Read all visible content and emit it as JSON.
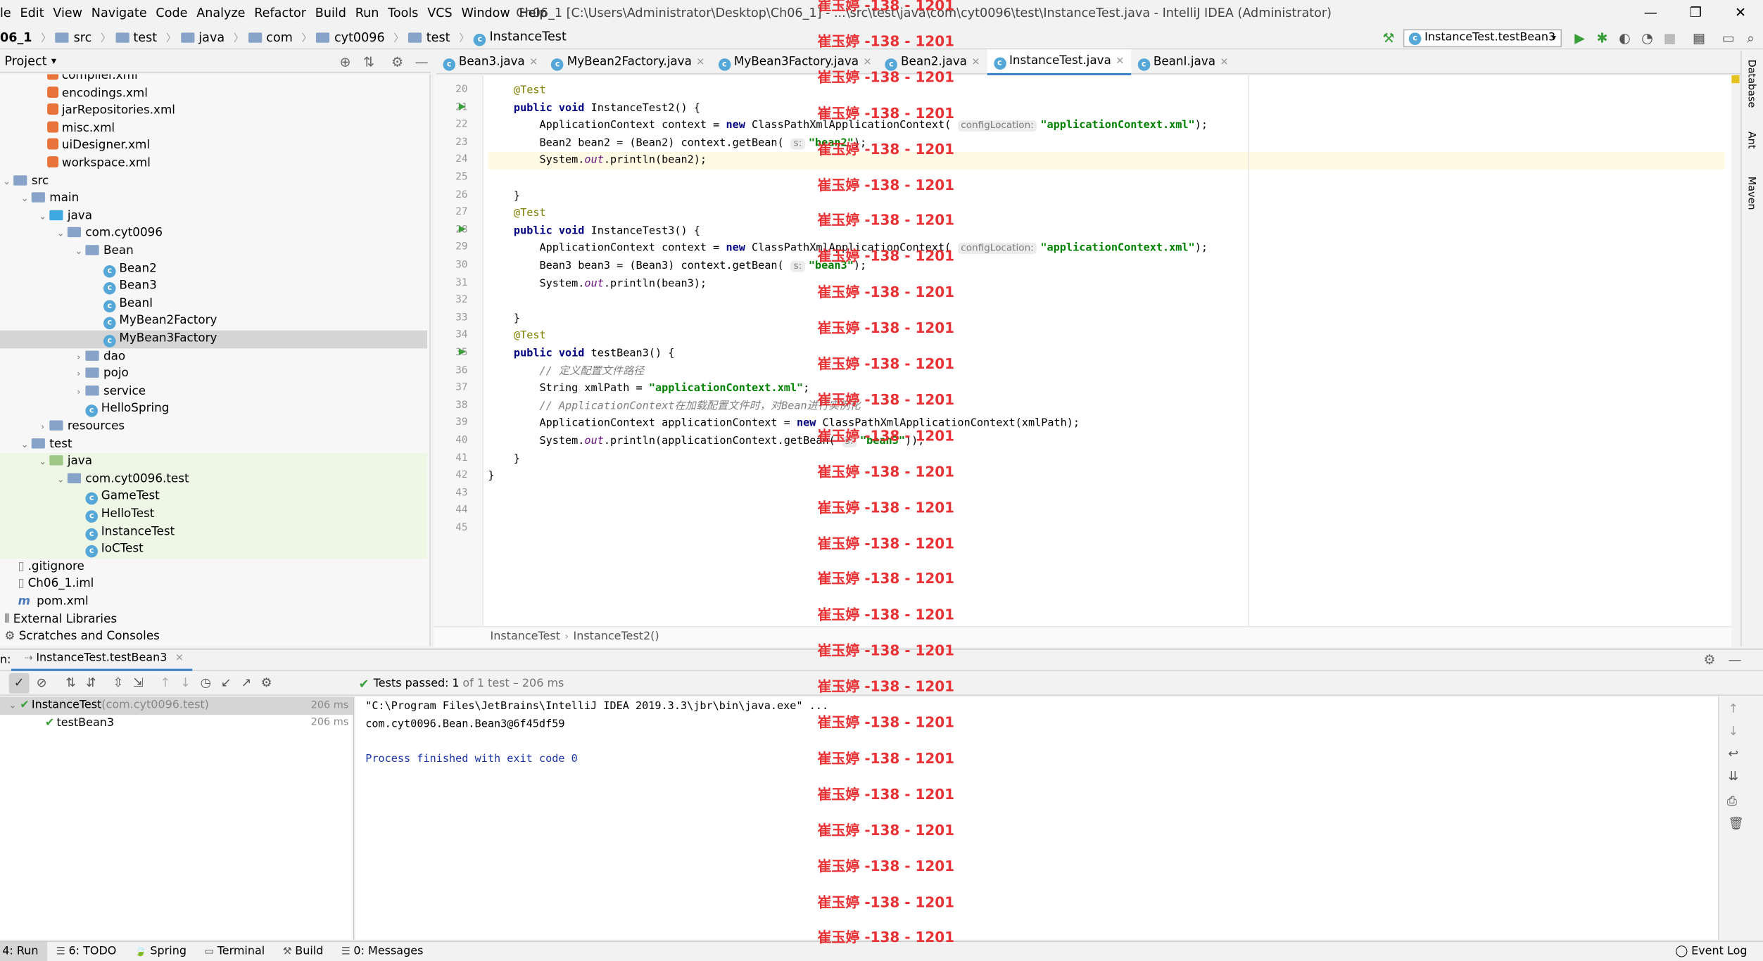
{
  "menu": [
    "le",
    "Edit",
    "View",
    "Navigate",
    "Code",
    "Analyze",
    "Refactor",
    "Build",
    "Run",
    "Tools",
    "VCS",
    "Window",
    "Help"
  ],
  "window_title": "Ch06_1 [C:\\Users\\Administrator\\Desktop\\Ch06_1] - ...\\src\\test\\java\\com\\cyt0096\\test\\InstanceTest.java - IntelliJ IDEA (Administrator)",
  "window_controls": {
    "minimize": "—",
    "restore": "❐",
    "close": "✕"
  },
  "breadcrumb": [
    "06_1",
    "src",
    "test",
    "java",
    "com",
    "cyt0096",
    "test",
    "InstanceTest"
  ],
  "run_config": "InstanceTest.testBean3",
  "project_panel": {
    "title": "Project",
    "dropdown": "▾"
  },
  "tree": [
    {
      "label": "compiler.xml",
      "indent": 30,
      "icon": "xml"
    },
    {
      "label": "encodings.xml",
      "indent": 30,
      "icon": "xml"
    },
    {
      "label": "jarRepositories.xml",
      "indent": 30,
      "icon": "xml"
    },
    {
      "label": "misc.xml",
      "indent": 30,
      "icon": "xml"
    },
    {
      "label": "uiDesigner.xml",
      "indent": 30,
      "icon": "xml"
    },
    {
      "label": "workspace.xml",
      "indent": 30,
      "icon": "xml"
    },
    {
      "label": "src",
      "indent": 0,
      "icon": "folder",
      "arrow": "v"
    },
    {
      "label": "main",
      "indent": 16,
      "icon": "folder",
      "arrow": "v"
    },
    {
      "label": "java",
      "indent": 32,
      "icon": "folder-blue",
      "arrow": "v"
    },
    {
      "label": "com.cyt0096",
      "indent": 48,
      "icon": "folder",
      "arrow": "v"
    },
    {
      "label": "Bean",
      "indent": 64,
      "icon": "folder",
      "arrow": "v"
    },
    {
      "label": "Bean2",
      "indent": 80,
      "icon": "class"
    },
    {
      "label": "Bean3",
      "indent": 80,
      "icon": "class"
    },
    {
      "label": "BeanI",
      "indent": 80,
      "icon": "class"
    },
    {
      "label": "MyBean2Factory",
      "indent": 80,
      "icon": "class"
    },
    {
      "label": "MyBean3Factory",
      "indent": 80,
      "icon": "class",
      "selected": true
    },
    {
      "label": "dao",
      "indent": 64,
      "icon": "folder",
      "arrow": ">"
    },
    {
      "label": "pojo",
      "indent": 64,
      "icon": "folder",
      "arrow": ">"
    },
    {
      "label": "service",
      "indent": 64,
      "icon": "folder",
      "arrow": ">"
    },
    {
      "label": "HelloSpring",
      "indent": 64,
      "icon": "class"
    },
    {
      "label": "resources",
      "indent": 32,
      "icon": "folder",
      "arrow": ">"
    },
    {
      "label": "test",
      "indent": 16,
      "icon": "folder",
      "arrow": "v"
    },
    {
      "label": "java",
      "indent": 32,
      "icon": "folder-green",
      "arrow": "v",
      "test": true
    },
    {
      "label": "com.cyt0096.test",
      "indent": 48,
      "icon": "folder",
      "arrow": "v",
      "test": true
    },
    {
      "label": "GameTest",
      "indent": 64,
      "icon": "class",
      "test": true
    },
    {
      "label": "HelloTest",
      "indent": 64,
      "icon": "class",
      "test": true
    },
    {
      "label": "InstanceTest",
      "indent": 64,
      "icon": "class",
      "test": true
    },
    {
      "label": "IoCTest",
      "indent": 64,
      "icon": "class",
      "test": true
    },
    {
      "label": ".gitignore",
      "indent": 4,
      "icon": "file"
    },
    {
      "label": "Ch06_1.iml",
      "indent": 4,
      "icon": "file"
    },
    {
      "label": "pom.xml",
      "indent": 4,
      "icon": "maven"
    },
    {
      "label": "External Libraries",
      "indent": -8,
      "icon": "lib",
      "arrow": ">"
    },
    {
      "label": "Scratches and Consoles",
      "indent": -8,
      "icon": "scratch",
      "arrow": ">"
    }
  ],
  "editor_tabs": [
    {
      "label": "Bean3.java",
      "active": false
    },
    {
      "label": "MyBean2Factory.java",
      "active": false
    },
    {
      "label": "MyBean3Factory.java",
      "active": false
    },
    {
      "label": "Bean2.java",
      "active": false
    },
    {
      "label": "InstanceTest.java",
      "active": true
    },
    {
      "label": "BeanI.java",
      "active": false
    }
  ],
  "code_lines": [
    {
      "n": "20",
      "html": "    <span class=\"ann\">@Test</span>"
    },
    {
      "n": "21",
      "html": "    <span class=\"kw\">public void</span> InstanceTest2() {",
      "run": true
    },
    {
      "n": "22",
      "html": "        ApplicationContext context = <span class=\"kw\">new</span> ClassPathXmlApplicationContext( <span class=\"hint\">configLocation:</span><span class=\"str\">\"applicationContext.xml\"</span>);"
    },
    {
      "n": "23",
      "html": "        Bean2 bean2 = (Bean2) context.getBean( <span class=\"hint\">s:</span><span class=\"str\">\"bean2\"</span>);"
    },
    {
      "n": "24",
      "html": "        System.<span class=\"fld\">out</span>.println(bean2);",
      "current": true
    },
    {
      "n": "25",
      "html": ""
    },
    {
      "n": "26",
      "html": "    }"
    },
    {
      "n": "27",
      "html": "    <span class=\"ann\">@Test</span>"
    },
    {
      "n": "28",
      "html": "    <span class=\"kw\">public void</span> InstanceTest3() {",
      "run": true
    },
    {
      "n": "29",
      "html": "        ApplicationContext context = <span class=\"kw\">new</span> ClassPathXmlApplicationContext( <span class=\"hint\">configLocation:</span><span class=\"str\">\"applicationContext.xml\"</span>);"
    },
    {
      "n": "30",
      "html": "        Bean3 bean3 = (Bean3) context.getBean( <span class=\"hint\">s:</span><span class=\"str\">\"bean3\"</span>);"
    },
    {
      "n": "31",
      "html": "        System.<span class=\"fld\">out</span>.println(bean3);"
    },
    {
      "n": "32",
      "html": ""
    },
    {
      "n": "33",
      "html": "    }"
    },
    {
      "n": "34",
      "html": "    <span class=\"ann\">@Test</span>"
    },
    {
      "n": "35",
      "html": "    <span class=\"kw\">public void</span> testBean3() {",
      "run": true
    },
    {
      "n": "36",
      "html": "        <span class=\"cmt\">// 定义配置文件路径</span>"
    },
    {
      "n": "37",
      "html": "        String xmlPath = <span class=\"str\">\"applicationContext.xml\"</span>;"
    },
    {
      "n": "38",
      "html": "        <span class=\"cmt\">// ApplicationContext在加载配置文件时，对Bean进行实例化</span>"
    },
    {
      "n": "39",
      "html": "        ApplicationContext applicationContext = <span class=\"kw\">new</span> ClassPathXmlApplicationContext(xmlPath);"
    },
    {
      "n": "40",
      "html": "        System.<span class=\"fld\">out</span>.println(applicationContext.getBean( <span class=\"hint\">s:</span><span class=\"str\">\"bean3\"</span>));"
    },
    {
      "n": "41",
      "html": "    }"
    },
    {
      "n": "42",
      "html": "}"
    },
    {
      "n": "43",
      "html": ""
    },
    {
      "n": "44",
      "html": ""
    },
    {
      "n": "45",
      "html": ""
    }
  ],
  "editor_breadcrumb": [
    "InstanceTest",
    "InstanceTest2()"
  ],
  "right_tools": [
    "Database",
    "Ant",
    "Maven"
  ],
  "run_panel": {
    "prefix": "n:",
    "tab": "InstanceTest.testBean3",
    "status_prefix": "Tests passed:",
    "status_value": "1",
    "status_suffix": "of 1 test – 206 ms"
  },
  "test_tree": [
    {
      "label": "InstanceTest",
      "sub": "(com.cyt0096.test)",
      "time": "206 ms"
    },
    {
      "label": "testBean3",
      "sub": "",
      "time": "206 ms"
    }
  ],
  "console_lines": [
    {
      "text": "\"C:\\Program Files\\JetBrains\\IntelliJ IDEA 2019.3.3\\jbr\\bin\\java.exe\" ...",
      "color": "#000"
    },
    {
      "text": "com.cyt0096.Bean.Bean3@6f45df59",
      "color": "#000"
    },
    {
      "text": "",
      "color": "#000"
    },
    {
      "text": "Process finished with exit code 0",
      "color": "#1a33a6"
    }
  ],
  "status_bar": [
    "4: Run",
    "6: TODO",
    "Spring",
    "Terminal",
    "Build",
    "0: Messages"
  ],
  "event_log": "Event Log",
  "watermark": "崔玉婷 -138 - 1201"
}
